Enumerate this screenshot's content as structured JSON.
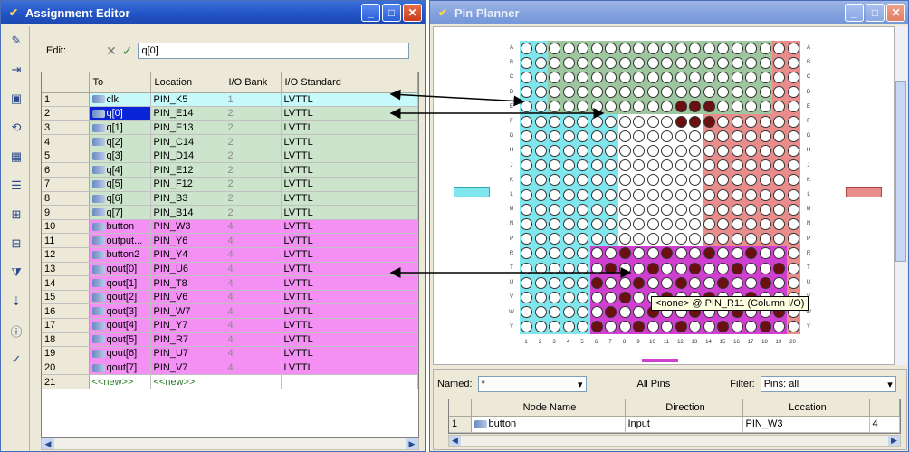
{
  "assignment_editor": {
    "title": "Assignment Editor",
    "edit_label": "Edit:",
    "edit_value": "q[0]",
    "columns": [
      "",
      "To",
      "Location",
      "I/O Bank",
      "I/O Standard"
    ],
    "rows": [
      {
        "num": "1",
        "to": "clk",
        "loc": "PIN_K5",
        "bank": "1",
        "std": "LVTTL",
        "color": "cyan"
      },
      {
        "num": "2",
        "to": "q[0]",
        "loc": "PIN_E14",
        "bank": "2",
        "std": "LVTTL",
        "color": "green",
        "selected": true
      },
      {
        "num": "3",
        "to": "q[1]",
        "loc": "PIN_E13",
        "bank": "2",
        "std": "LVTTL",
        "color": "green"
      },
      {
        "num": "4",
        "to": "q[2]",
        "loc": "PIN_C14",
        "bank": "2",
        "std": "LVTTL",
        "color": "green"
      },
      {
        "num": "5",
        "to": "q[3]",
        "loc": "PIN_D14",
        "bank": "2",
        "std": "LVTTL",
        "color": "green"
      },
      {
        "num": "6",
        "to": "q[4]",
        "loc": "PIN_E12",
        "bank": "2",
        "std": "LVTTL",
        "color": "green"
      },
      {
        "num": "7",
        "to": "q[5]",
        "loc": "PIN_F12",
        "bank": "2",
        "std": "LVTTL",
        "color": "green"
      },
      {
        "num": "8",
        "to": "q[6]",
        "loc": "PIN_B3",
        "bank": "2",
        "std": "LVTTL",
        "color": "green"
      },
      {
        "num": "9",
        "to": "q[7]",
        "loc": "PIN_B14",
        "bank": "2",
        "std": "LVTTL",
        "color": "green"
      },
      {
        "num": "10",
        "to": "button",
        "loc": "PIN_W3",
        "bank": "4",
        "std": "LVTTL",
        "color": "pink"
      },
      {
        "num": "11",
        "to": "output...",
        "loc": "PIN_Y6",
        "bank": "4",
        "std": "LVTTL",
        "color": "pink"
      },
      {
        "num": "12",
        "to": "button2",
        "loc": "PIN_Y4",
        "bank": "4",
        "std": "LVTTL",
        "color": "pink"
      },
      {
        "num": "13",
        "to": "qout[0]",
        "loc": "PIN_U6",
        "bank": "4",
        "std": "LVTTL",
        "color": "pink"
      },
      {
        "num": "14",
        "to": "qout[1]",
        "loc": "PIN_T8",
        "bank": "4",
        "std": "LVTTL",
        "color": "pink"
      },
      {
        "num": "15",
        "to": "qout[2]",
        "loc": "PIN_V6",
        "bank": "4",
        "std": "LVTTL",
        "color": "pink"
      },
      {
        "num": "16",
        "to": "qout[3]",
        "loc": "PIN_W7",
        "bank": "4",
        "std": "LVTTL",
        "color": "pink"
      },
      {
        "num": "17",
        "to": "qout[4]",
        "loc": "PIN_Y7",
        "bank": "4",
        "std": "LVTTL",
        "color": "pink"
      },
      {
        "num": "18",
        "to": "qout[5]",
        "loc": "PIN_R7",
        "bank": "4",
        "std": "LVTTL",
        "color": "pink"
      },
      {
        "num": "19",
        "to": "qout[6]",
        "loc": "PIN_U7",
        "bank": "4",
        "std": "LVTTL",
        "color": "pink"
      },
      {
        "num": "20",
        "to": "qout[7]",
        "loc": "PIN_V7",
        "bank": "4",
        "std": "LVTTL",
        "color": "pink"
      },
      {
        "num": "21",
        "to": "<<new>>",
        "loc": "<<new>>",
        "bank": "",
        "std": "",
        "color": "new"
      }
    ],
    "toolbar_icons": [
      "pencil-icon",
      "pin-assign-icon",
      "chip-icon",
      "refresh-icon",
      "pin-table-icon",
      "rows-icon",
      "add-column-icon",
      "remove-column-icon",
      "filter-icon",
      "node-finder-icon",
      "info-icon",
      "check-icon"
    ]
  },
  "pin_planner": {
    "title": "Pin Planner",
    "tooltip": "<none> @ PIN_R11 (Column I/O)",
    "row_letters": [
      "A",
      "B",
      "C",
      "D",
      "E",
      "F",
      "G",
      "H",
      "J",
      "K",
      "L",
      "M",
      "N",
      "P",
      "R",
      "T",
      "U",
      "V",
      "W",
      "Y"
    ],
    "col_numbers": [
      "1",
      "2",
      "3",
      "4",
      "5",
      "6",
      "7",
      "8",
      "9",
      "10",
      "11",
      "12",
      "13",
      "14",
      "15",
      "16",
      "17",
      "18",
      "19",
      "20"
    ],
    "named_label": "Named:",
    "named_value": "*",
    "all_pins_label": "All Pins",
    "filter_label": "Filter:",
    "filter_value": "Pins: all",
    "node_columns": [
      "",
      "Node Name",
      "Direction",
      "Location",
      ""
    ],
    "node_rows": [
      {
        "num": "1",
        "name": "button",
        "direction": "Input",
        "location": "PIN_W3",
        "extra": "4"
      }
    ]
  },
  "colors": {
    "bank_green": "#9fc79f",
    "bank_cyan": "#7fe6ee",
    "bank_red": "#e88c8c",
    "bank_pink": "#d040d0",
    "title_active": "#2152c4"
  }
}
